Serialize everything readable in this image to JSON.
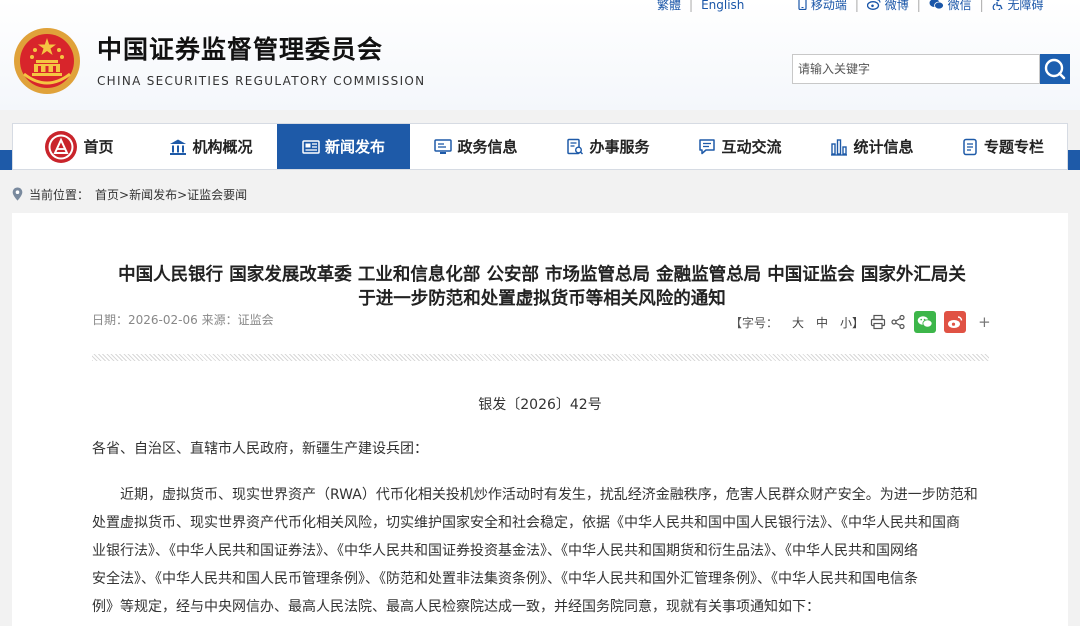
{
  "toplinks": {
    "traditional": "繁體",
    "english": "English",
    "mobile": "移动端",
    "weibo": "微博",
    "wechat": "微信",
    "accessibility": "无障碍"
  },
  "site": {
    "title": "中国证券监督管理委员会",
    "subtitle": "CHINA SECURITIES REGULATORY COMMISSION"
  },
  "search": {
    "placeholder": "请输入关键字"
  },
  "nav": {
    "items": [
      {
        "label": "首页",
        "icon": "csrc-logo-icon"
      },
      {
        "label": "机构概况",
        "icon": "building-icon"
      },
      {
        "label": "新闻发布",
        "icon": "newspaper-icon",
        "active": true
      },
      {
        "label": "政务信息",
        "icon": "monitor-icon"
      },
      {
        "label": "办事服务",
        "icon": "document-search-icon"
      },
      {
        "label": "互动交流",
        "icon": "chat-icon"
      },
      {
        "label": "统计信息",
        "icon": "bar-chart-icon"
      },
      {
        "label": "专题专栏",
        "icon": "notebook-icon"
      }
    ]
  },
  "breadcrumb": {
    "label": "当前位置：",
    "path": "首页>新闻发布>证监会要闻"
  },
  "article": {
    "title_line1": "中国人民银行 国家发展改革委 工业和信息化部 公安部 市场监管总局 金融监管总局 中国证监会 国家外汇局关",
    "title_line2": "于进一步防范和处置虚拟货币等相关风险的通知",
    "date_label": "日期：",
    "date": "2026-02-06",
    "source_label": "来源：",
    "source": "证监会",
    "font_size_label": "【字号：",
    "size_large": "大",
    "size_medium": "中",
    "size_small": "小】",
    "plus": "+",
    "doc_number": "银发〔2026〕42号",
    "salutation": "各省、自治区、直辖市人民政府，新疆生产建设兵团：",
    "body_lines": [
      "近期，虚拟货币、现实世界资产（RWA）代币化相关投机炒作活动时有发生，扰乱经济金融秩序，危害人民群众财产安全。为进一步防范和",
      "处置虚拟货币、现实世界资产代币化相关风险，切实维护国家安全和社会稳定，依据《中华人民共和国中国人民银行法》、《中华人民共和国商",
      "业银行法》、《中华人民共和国证券法》、《中华人民共和国证券投资基金法》、《中华人民共和国期货和衍生品法》、《中华人民共和国网络",
      "安全法》、《中华人民共和国人民币管理条例》、《防范和处置非法集资条例》、《中华人民共和国外汇管理条例》、《中华人民共和国电信条",
      "例》等规定，经与中央网信办、最高人民法院、最高人民检察院达成一致，并经国务院同意，现就有关事项通知如下："
    ]
  },
  "colors": {
    "brand_blue": "#1e5aa8",
    "wechat_green": "#3db64a",
    "weibo_red": "#e05244"
  }
}
